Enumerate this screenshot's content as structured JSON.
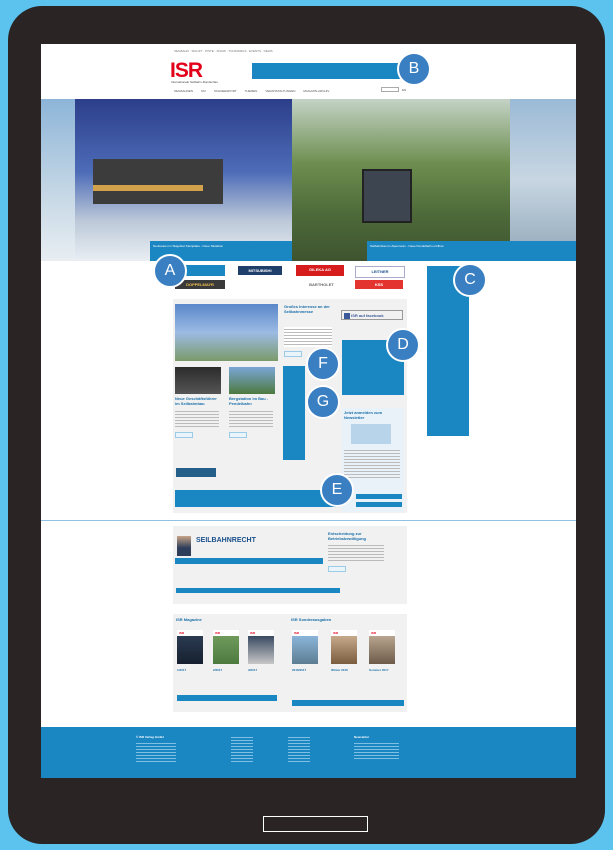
{
  "header": {
    "topline": "SEILBAHN · SKILIFT · PISTE · SNOW · TOURISMUS · EVENTS · NEWS",
    "logo_text": "ISR",
    "logo_subtitle": "Internationale Seilbahn-Rundschau",
    "nav": [
      "SEILBAHNEN",
      "SKI",
      "SCHNEESPORT",
      "THEMEN",
      "VERANSTALTUNGEN",
      "MAGAZIN-ARCHIV"
    ],
    "lang": "EN"
  },
  "hero": {
    "caption_left": "Neubauten im Skigebiet Steinplatte - Neue Talstation",
    "caption_right": "Seilbahnbau im Alpenraum - Neue Pendelbahn eröffnet"
  },
  "markers": {
    "a": "A",
    "b": "B",
    "c": "C",
    "d": "D",
    "e": "E",
    "f": "F",
    "g": "G"
  },
  "sponsors": [
    "DOPPELMAYR",
    "MITSUBISHI",
    "GILEKA AG",
    "LEITNER",
    "BARTHOLET",
    "KSS"
  ],
  "articles": {
    "main_title": "Großes Interesse an der Seilbahnmesse",
    "card1_title": "Neue Geschäftsführer im Seilbahnbau",
    "card2_title": "Bergstation im Bau - Pendelbahn",
    "more_button": "Alle Artikel"
  },
  "facebook_label": "ISR auf facebook",
  "newsletter_title": "Jetzt anmelden zum Newsletter",
  "seilbahnrecht": {
    "label": "SEILBAHNRECHT",
    "title": "Entscheidung zur Betriebsbewilligung"
  },
  "magazines": {
    "title_left": "ISR Magazine",
    "title_right": "ISR Sonderausgaben",
    "items_left": [
      "1/2017",
      "2/2017",
      "3/2017"
    ],
    "items_right": [
      "2016/2017",
      "Winter 2016",
      "Sommer 2017"
    ]
  },
  "footer": {
    "col1_title": "© ISR Verlag GmbH",
    "col4_title": "Newsletter"
  },
  "colors": {
    "accent": "#1a86c2",
    "brand_red": "#e2001a",
    "bezel": "#2a2524",
    "background": "#5bc3ee"
  }
}
